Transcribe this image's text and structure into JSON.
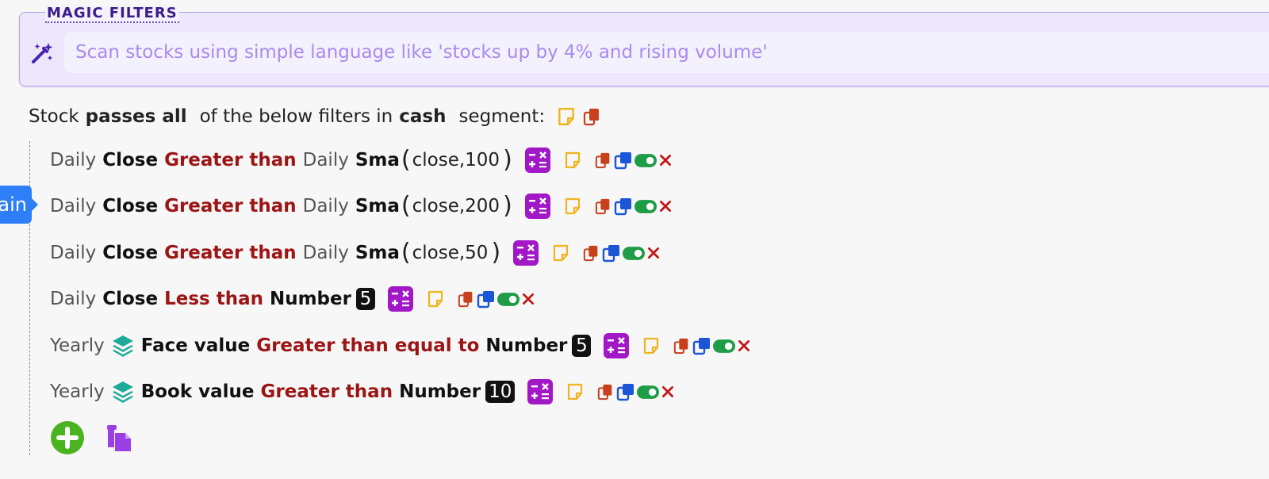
{
  "magic": {
    "title": "MAGIC FILTERS",
    "placeholder": "Scan stocks using simple language like 'stocks up by 4% and rising volume'"
  },
  "summary": {
    "prefix": "Stock",
    "mode": "passes all",
    "middle": "of the below filters in",
    "segment": "cash",
    "suffix": "segment:"
  },
  "side_tab": {
    "label": "ain"
  },
  "filters": [
    {
      "period": "Daily",
      "field": "Close",
      "operator": "Greater than",
      "rhs_period": "Daily",
      "rhs_indicator": "Sma",
      "rhs_args": "close,100"
    },
    {
      "period": "Daily",
      "field": "Close",
      "operator": "Greater than",
      "rhs_period": "Daily",
      "rhs_indicator": "Sma",
      "rhs_args": "close,200"
    },
    {
      "period": "Daily",
      "field": "Close",
      "operator": "Greater than",
      "rhs_period": "Daily",
      "rhs_indicator": "Sma",
      "rhs_args": "close,50"
    },
    {
      "period": "Daily",
      "field": "Close",
      "operator": "Less than",
      "rhs_type": "Number",
      "rhs_value": "5"
    },
    {
      "period": "Yearly",
      "field": "Face value",
      "operator": "Greater than equal to",
      "rhs_type": "Number",
      "rhs_value": "5"
    },
    {
      "period": "Yearly",
      "field": "Book value",
      "operator": "Greater than",
      "rhs_type": "Number",
      "rhs_value": "10"
    }
  ],
  "colors": {
    "operator": "#9c1515",
    "calc_icon": "#a217c6",
    "note_icon": "#f0b41e",
    "copy_icon": "#c8401b",
    "duplicate_icon": "#1b56d6",
    "toggle_icon": "#1f9d46",
    "delete_icon": "#c31515",
    "add_icon": "#4cb320",
    "paste_icon": "#9a3ee6",
    "tab": "#2d7ef7"
  },
  "icons": [
    "magic-wand-icon",
    "layers-icon",
    "calculator-icon",
    "note-icon",
    "copy-icon",
    "duplicate-icon",
    "toggle-icon",
    "delete-icon",
    "add-icon",
    "paste-icon"
  ]
}
